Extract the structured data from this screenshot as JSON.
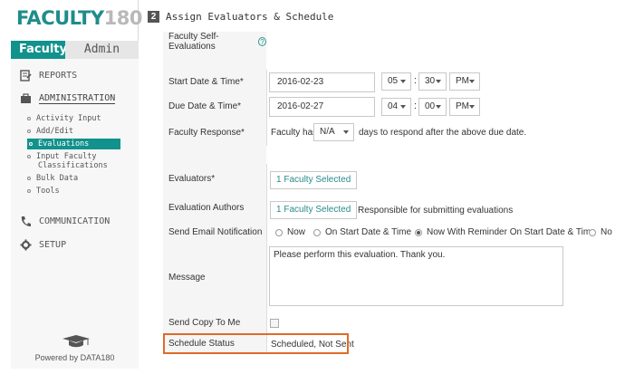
{
  "brand": {
    "logo_text": "FACULTY",
    "logo_number": "180"
  },
  "tabs": {
    "faculty": "Faculty",
    "admin": "Admin"
  },
  "nav": {
    "reports": "REPORTS",
    "administration": "ADMINISTRATION",
    "admin_items": [
      "Activity Input",
      "Add/Edit",
      "Evaluations",
      "Input Faculty",
      "Classifications",
      "Bulk Data",
      "Tools"
    ],
    "communication": "COMMUNICATION",
    "setup": "SETUP"
  },
  "footer": {
    "powered": "Powered by DATA180"
  },
  "section": {
    "number": "2",
    "title": "Assign Evaluators & Schedule"
  },
  "form": {
    "self_eval_label": "Faculty Self-Evaluations",
    "start_label": "Start Date & Time*",
    "start_date": "2016-02-23",
    "start_hour": "05",
    "start_min": "30",
    "start_ampm": "PM",
    "due_label": "Due Date & Time*",
    "due_date": "2016-02-27",
    "due_hour": "04",
    "due_min": "00",
    "due_ampm": "PM",
    "colon": ":",
    "response_label": "Faculty Response*",
    "response_prefix": "Faculty has",
    "response_value": "N/A",
    "response_suffix": "days to respond after the above due date.",
    "evaluators_label": "Evaluators*",
    "evaluators_button": "1 Faculty Selected",
    "authors_label": "Evaluation Authors",
    "authors_button": "1 Faculty Selected",
    "authors_note": "Responsible for submitting evaluations",
    "email_label": "Send Email Notification",
    "email_options": [
      "Now",
      "On Start Date & Time",
      "Now With Reminder On Start Date & Time",
      "No"
    ],
    "email_selected_index": 2,
    "message_label": "Message",
    "message_value": "Please perform this evaluation. Thank you.",
    "copy_label": "Send Copy To Me",
    "status_label": "Schedule Status",
    "status_value": "Scheduled, Not Sent"
  },
  "colors": {
    "accent": "#11928c",
    "highlight": "#e06a2b"
  }
}
